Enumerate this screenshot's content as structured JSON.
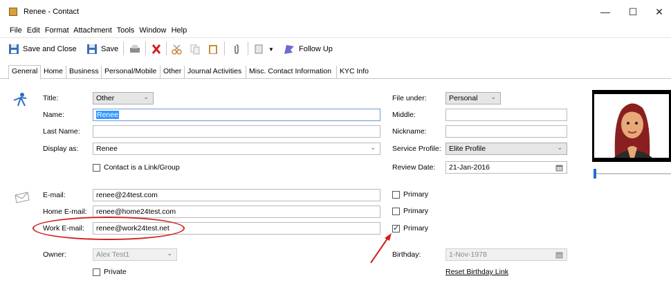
{
  "window": {
    "title": "Renee - Contact",
    "minimize": "—",
    "maximize": "☐",
    "close": "✕"
  },
  "menu": [
    "File",
    "Edit",
    "Format",
    "Attachment",
    "Tools",
    "Window",
    "Help"
  ],
  "toolbar": {
    "save_close": "Save and Close",
    "save": "Save",
    "follow_up": "Follow Up"
  },
  "tabs": [
    "General",
    "Home",
    "Business",
    "Personal/Mobile",
    "Other",
    "Journal Activities",
    "Misc. Contact Information",
    "KYC Info"
  ],
  "form": {
    "title_label": "Title:",
    "title_value": "Other",
    "name_label": "Name:",
    "name_value": "Renee",
    "lastname_label": "Last Name:",
    "lastname_value": "",
    "display_label": "Display as:",
    "display_value": "Renee",
    "contact_link_label": "Contact is a Link/Group",
    "email_label": "E-mail:",
    "email_value": "renee@24test.com",
    "home_email_label": "Home E-mail:",
    "home_email_value": "renee@home24test.com",
    "work_email_label": "Work E-mail:",
    "work_email_value": "renee@work24test.net",
    "owner_label": "Owner:",
    "owner_value": "Alex Test1",
    "private_label": "Private",
    "primary_label": "Primary",
    "file_under_label": "File under:",
    "file_under_value": "Personal",
    "middle_label": "Middle:",
    "middle_value": "",
    "nickname_label": "Nickname:",
    "nickname_value": "",
    "service_profile_label": "Service Profile:",
    "service_profile_value": "Elite Profile",
    "review_date_label": "Review Date:",
    "review_date_value": "21-Jan-2016",
    "birthday_label": "Birthday:",
    "birthday_value": "1-Nov-1978",
    "reset_birthday_link": "Reset Birthday Link"
  },
  "colors": {
    "annotation": "#d21f1f",
    "highlight": "#3399ff"
  }
}
